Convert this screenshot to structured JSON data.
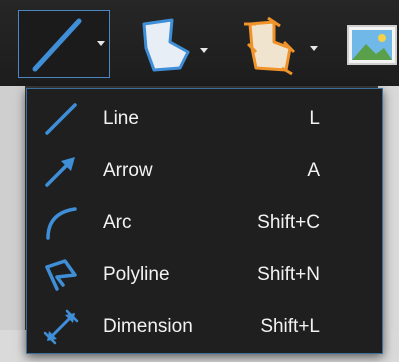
{
  "toolbar": {
    "tools": [
      {
        "icon": "line-tool-icon",
        "active": true
      },
      {
        "icon": "shape-tool-icon"
      },
      {
        "icon": "freehand-shape-tool-icon"
      },
      {
        "icon": "image-tool-icon"
      }
    ]
  },
  "menu": {
    "items": [
      {
        "label": "Line",
        "shortcut": "L",
        "icon": "line-icon"
      },
      {
        "label": "Arrow",
        "shortcut": "A",
        "icon": "arrow-icon"
      },
      {
        "label": "Arc",
        "shortcut": "Shift+C",
        "icon": "arc-icon"
      },
      {
        "label": "Polyline",
        "shortcut": "Shift+N",
        "icon": "polyline-icon"
      },
      {
        "label": "Dimension",
        "shortcut": "Shift+L",
        "icon": "dimension-icon"
      }
    ]
  },
  "colors": {
    "accent": "#3f8fd8",
    "text": "#f2f2f2",
    "menu_bg": "#1f1f1f"
  }
}
